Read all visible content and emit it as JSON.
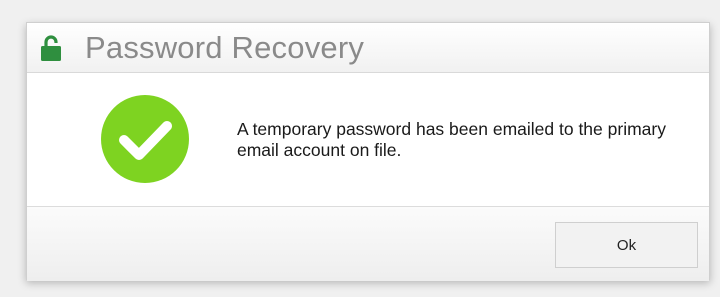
{
  "dialog": {
    "title": "Password Recovery",
    "title_icon": "unlocked-padlock-icon",
    "status_icon": "checkmark-circle-icon",
    "message": "A temporary password has been emailed to the primary email account on file.",
    "ok_label": "Ok"
  },
  "colors": {
    "lock_icon": "#2f8f3f",
    "check_circle": "#7ed321",
    "title_text": "#8a8a8a"
  }
}
